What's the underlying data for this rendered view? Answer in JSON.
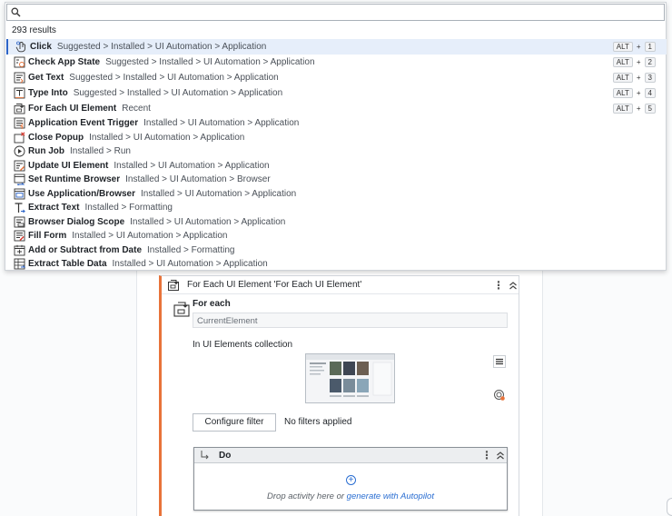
{
  "search": {
    "placeholder": "",
    "value": "",
    "results_count": "293 results"
  },
  "results": [
    {
      "name": "Click",
      "path": "Suggested > Installed > UI Automation > Application",
      "icon": "click-icon",
      "shortcut_mod": "ALT",
      "shortcut_key": "1",
      "selected": true
    },
    {
      "name": "Check App State",
      "path": "Suggested > Installed > UI Automation > Application",
      "icon": "check-app-state-icon",
      "shortcut_mod": "ALT",
      "shortcut_key": "2"
    },
    {
      "name": "Get Text",
      "path": "Suggested > Installed > UI Automation > Application",
      "icon": "get-text-icon",
      "shortcut_mod": "ALT",
      "shortcut_key": "3"
    },
    {
      "name": "Type Into",
      "path": "Suggested > Installed > UI Automation > Application",
      "icon": "type-into-icon",
      "shortcut_mod": "ALT",
      "shortcut_key": "4"
    },
    {
      "name": "For Each UI Element",
      "path": "Recent",
      "icon": "for-each-ui-element-icon",
      "shortcut_mod": "ALT",
      "shortcut_key": "5"
    },
    {
      "name": "Application Event Trigger",
      "path": "Installed > UI Automation > Application",
      "icon": "event-trigger-icon"
    },
    {
      "name": "Close Popup",
      "path": "Installed > UI Automation > Application",
      "icon": "close-popup-icon"
    },
    {
      "name": "Run Job",
      "path": "Installed > Run",
      "icon": "run-job-icon"
    },
    {
      "name": "Update UI Element",
      "path": "Installed > UI Automation > Application",
      "icon": "update-ui-element-icon"
    },
    {
      "name": "Set Runtime Browser",
      "path": "Installed > UI Automation > Browser",
      "icon": "set-runtime-browser-icon"
    },
    {
      "name": "Use Application/Browser",
      "path": "Installed > UI Automation > Application",
      "icon": "use-application-icon"
    },
    {
      "name": "Extract Text",
      "path": "Installed > Formatting",
      "icon": "extract-text-icon"
    },
    {
      "name": "Browser Dialog Scope",
      "path": "Installed > UI Automation > Application",
      "icon": "browser-dialog-icon"
    },
    {
      "name": "Fill Form",
      "path": "Installed > UI Automation > Application",
      "icon": "fill-form-icon"
    },
    {
      "name": "Add or Subtract from Date",
      "path": "Installed > Formatting",
      "icon": "date-icon"
    },
    {
      "name": "Extract Table Data",
      "path": "Installed > UI Automation > Application",
      "icon": "extract-table-icon"
    }
  ],
  "activity": {
    "title": "For Each UI Element 'For Each UI Element'",
    "for_each_label": "For each",
    "for_each_value": "CurrentElement",
    "collection_label": "In UI Elements collection",
    "configure_filter": "Configure filter",
    "filter_status": "No filters applied",
    "do_title": "Do",
    "drop_text": "Drop activity here or ",
    "drop_link": "generate with Autopilot"
  },
  "colors": {
    "accent": "#2b63c7",
    "selected_row": "#e6eefa",
    "activity_border": "#e8733a",
    "link": "#2a6ed2"
  }
}
